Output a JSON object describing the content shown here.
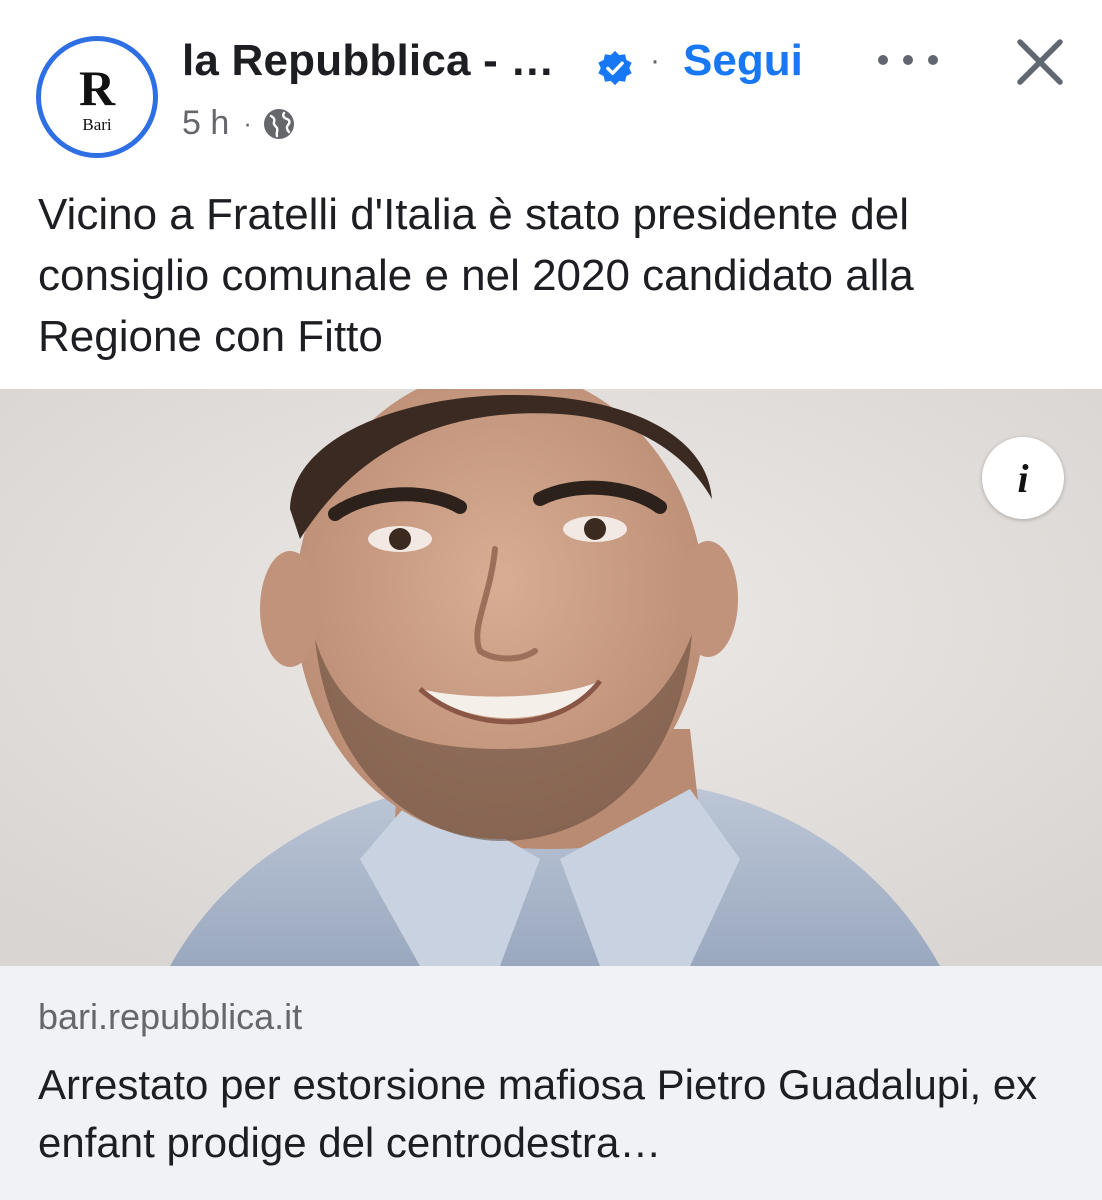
{
  "post": {
    "page_name": "la Repubblica - …",
    "avatar": {
      "letter": "R",
      "label": "Bari"
    },
    "follow_label": "Segui",
    "time": "5 h",
    "visibility_icon": "globe-icon",
    "text": "Vicino a Fratelli d'Italia è stato presidente del consiglio comunale e nel 2020 candidato alla Regione con Fitto"
  },
  "link": {
    "domain": "bari.repubblica.it",
    "title": "Arrestato per estorsione mafiosa Pietro Guadalupi, ex enfant prodige del centrodestra…",
    "info_label": "i"
  },
  "colors": {
    "accent": "#1877f2",
    "avatar_ring": "#2f6fe4",
    "card_bg": "#f0f2f5",
    "secondary_text": "#65676b"
  }
}
